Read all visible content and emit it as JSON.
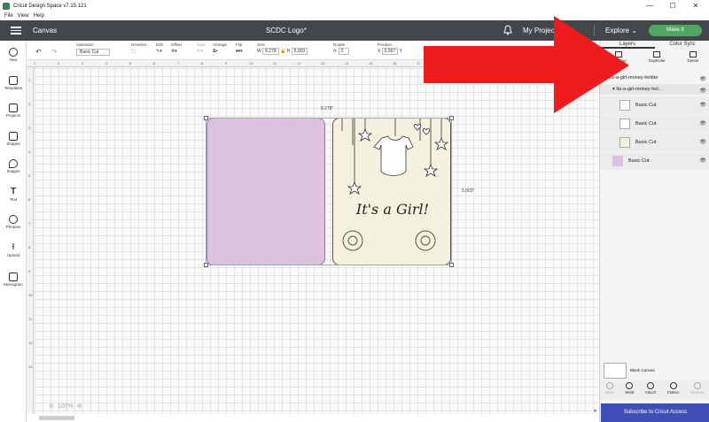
{
  "window": {
    "title": "Cricut Design Space  v7.15.121",
    "controls": [
      "—",
      "☐",
      "✕"
    ]
  },
  "menu": [
    "File",
    "View",
    "Help"
  ],
  "header": {
    "canvas_label": "Canvas",
    "doc_title": "SCDC Logo*",
    "projects": "My Projects",
    "explore": "Explore",
    "make_it": "Make It"
  },
  "toolbar": {
    "operation_label": "Operation",
    "operation_value": "Basic Cut",
    "deselect": "Deselect",
    "edit": "Edit",
    "offset": "Offset",
    "align": "Align",
    "arrange": "Arrange",
    "flip": "Flip",
    "size": "Size",
    "w_label": "W",
    "w_value": "8.278",
    "h_label": "H",
    "h_value": "5.003",
    "rotate": "Rotate",
    "rotate_value": "0",
    "position": "Position",
    "x_label": "X",
    "x_value": "5.597",
    "y_label": "Y"
  },
  "sidebar": {
    "items": [
      "New",
      "Templates",
      "Projects",
      "Shapes",
      "Images",
      "Text",
      "Phrases",
      "Upload",
      "Monogram"
    ]
  },
  "rulers": {
    "top": [
      "1",
      "2",
      "3",
      "4",
      "5",
      "6",
      "7",
      "8",
      "9",
      "10",
      "11",
      "12",
      "13",
      "14",
      "15",
      "16",
      "17",
      "18",
      "19",
      "20",
      "21",
      "22",
      "23",
      "24"
    ],
    "left": [
      "1",
      "2",
      "3",
      "4",
      "5",
      "6",
      "7",
      "8",
      "9",
      "10",
      "11",
      "12",
      "13"
    ]
  },
  "canvas": {
    "width_dim": "8.278\"",
    "height_dim": "5.003\"",
    "zoom": "100%",
    "card_text": "It's a Girl!",
    "colors": {
      "left_card": "#dcc2df",
      "right_card": "#f4f2dc"
    }
  },
  "panel": {
    "tabs": [
      "Layers",
      "Color Sync"
    ],
    "actions": [
      "Ungroup",
      "Duplicate",
      "Delete"
    ],
    "group_name": "Its-a-girl-money-holder",
    "subgroup_name": "Its-a-girl-money-hol...",
    "layers": [
      "Basic Cut",
      "Basic Cut",
      "Basic Cut",
      "Basic Cut"
    ],
    "blank_canvas": "Blank Canvas",
    "tools": [
      "Slice",
      "Weld",
      "Attach",
      "Flatten",
      "Contour"
    ],
    "subscribe": "Subscribe to Cricut Access"
  }
}
